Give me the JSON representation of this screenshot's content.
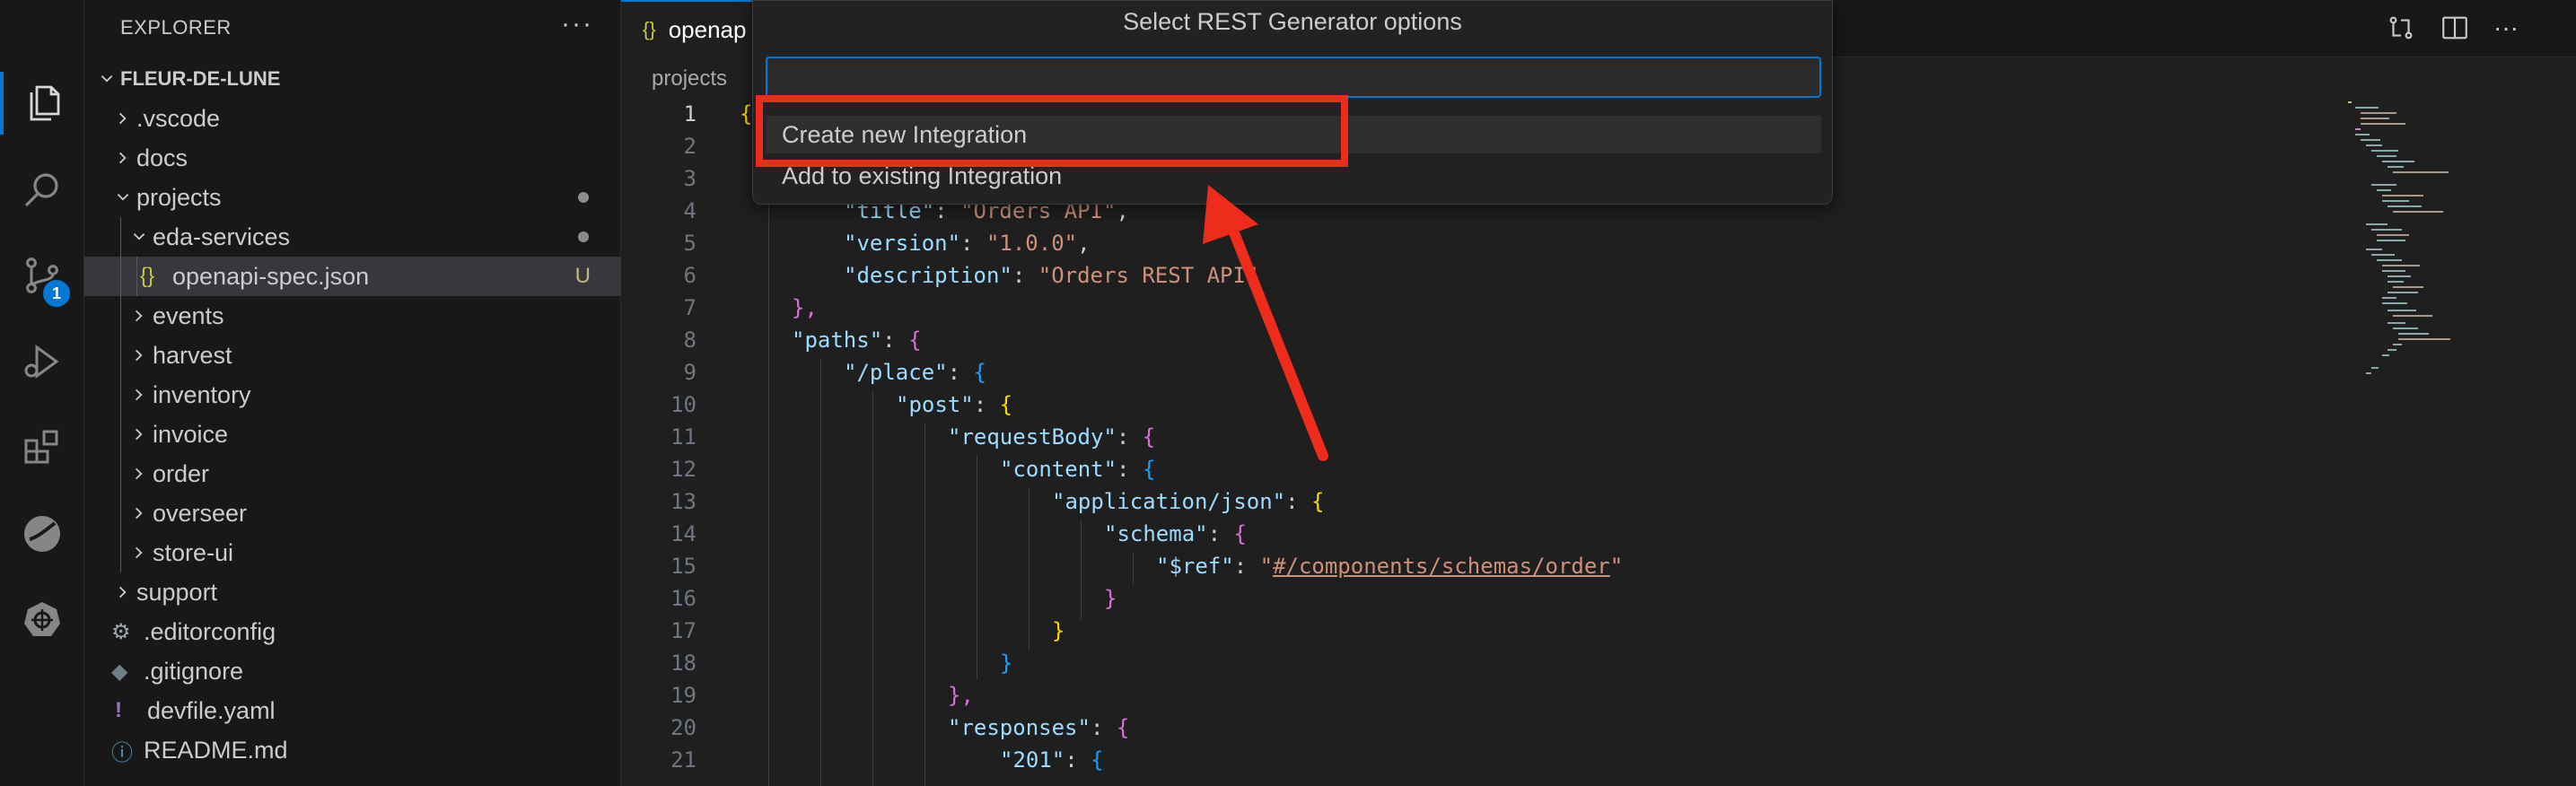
{
  "activity_bar": {
    "items": [
      {
        "icon": "files-icon",
        "active": true
      },
      {
        "icon": "search-icon"
      },
      {
        "icon": "source-control-icon",
        "badge": "1"
      },
      {
        "icon": "run-debug-icon"
      },
      {
        "icon": "extensions-icon"
      },
      {
        "icon": "red-hat-icon"
      },
      {
        "icon": "kubernetes-icon"
      }
    ]
  },
  "sidebar": {
    "title": "EXPLORER",
    "more": "···",
    "root": "FLEUR-DE-LUNE",
    "items": [
      {
        "label": ".vscode",
        "kind": "folder",
        "depth": 1,
        "expanded": false
      },
      {
        "label": "docs",
        "kind": "folder",
        "depth": 1,
        "expanded": false
      },
      {
        "label": "projects",
        "kind": "folder",
        "depth": 1,
        "expanded": true,
        "dot": true
      },
      {
        "label": "eda-services",
        "kind": "folder",
        "depth": 2,
        "expanded": true,
        "dot": true
      },
      {
        "label": "openapi-spec.json",
        "kind": "json",
        "depth": 3,
        "status": "U",
        "selected": true
      },
      {
        "label": "events",
        "kind": "folder",
        "depth": 2,
        "expanded": false
      },
      {
        "label": "harvest",
        "kind": "folder",
        "depth": 2,
        "expanded": false
      },
      {
        "label": "inventory",
        "kind": "folder",
        "depth": 2,
        "expanded": false
      },
      {
        "label": "invoice",
        "kind": "folder",
        "depth": 2,
        "expanded": false
      },
      {
        "label": "order",
        "kind": "folder",
        "depth": 2,
        "expanded": false
      },
      {
        "label": "overseer",
        "kind": "folder",
        "depth": 2,
        "expanded": false
      },
      {
        "label": "store-ui",
        "kind": "folder",
        "depth": 2,
        "expanded": false
      },
      {
        "label": "support",
        "kind": "folder",
        "depth": 1,
        "expanded": false
      },
      {
        "label": ".editorconfig",
        "kind": "gear",
        "depth": 1
      },
      {
        "label": ".gitignore",
        "kind": "git",
        "depth": 1
      },
      {
        "label": "devfile.yaml",
        "kind": "yaml",
        "depth": 1
      },
      {
        "label": "README.md",
        "kind": "info",
        "depth": 1
      }
    ]
  },
  "editor": {
    "tab_label": "openap",
    "breadcrumb": "projects",
    "lines": [
      {
        "n": "1",
        "current": true
      },
      {
        "n": "2"
      },
      {
        "n": "3"
      },
      {
        "n": "4"
      },
      {
        "n": "5"
      },
      {
        "n": "6"
      },
      {
        "n": "7"
      },
      {
        "n": "8"
      },
      {
        "n": "9"
      },
      {
        "n": "10"
      },
      {
        "n": "11"
      },
      {
        "n": "12"
      },
      {
        "n": "13"
      },
      {
        "n": "14"
      },
      {
        "n": "15"
      },
      {
        "n": "16"
      },
      {
        "n": "17"
      },
      {
        "n": "18"
      },
      {
        "n": "19"
      },
      {
        "n": "20"
      },
      {
        "n": "21"
      }
    ],
    "code": {
      "l1": "{",
      "l4_key": "\"title\"",
      "l4_val": "\"Orders API\"",
      "l5_key": "\"version\"",
      "l5_val": "\"1.0.0\"",
      "l6_key": "\"description\"",
      "l6_val": "\"Orders REST API\"",
      "l7": "},",
      "l8_key": "\"paths\"",
      "l9_key": "\"/place\"",
      "l10_key": "\"post\"",
      "l11_key": "\"requestBody\"",
      "l12_key": "\"content\"",
      "l13_key": "\"application/json\"",
      "l14_key": "\"schema\"",
      "l15_key": "\"$ref\"",
      "l15_val": "#/components/schemas/order",
      "l19": "},",
      "l20_key": "\"responses\"",
      "l21_key": "\"201\""
    }
  },
  "quick_pick": {
    "title": "Select REST Generator options",
    "input_value": "",
    "options": [
      {
        "label": "Create new Integration",
        "focused": true
      },
      {
        "label": "Add to existing Integration"
      }
    ]
  },
  "annotation": {
    "highlight_color": "#ee2c1c"
  }
}
